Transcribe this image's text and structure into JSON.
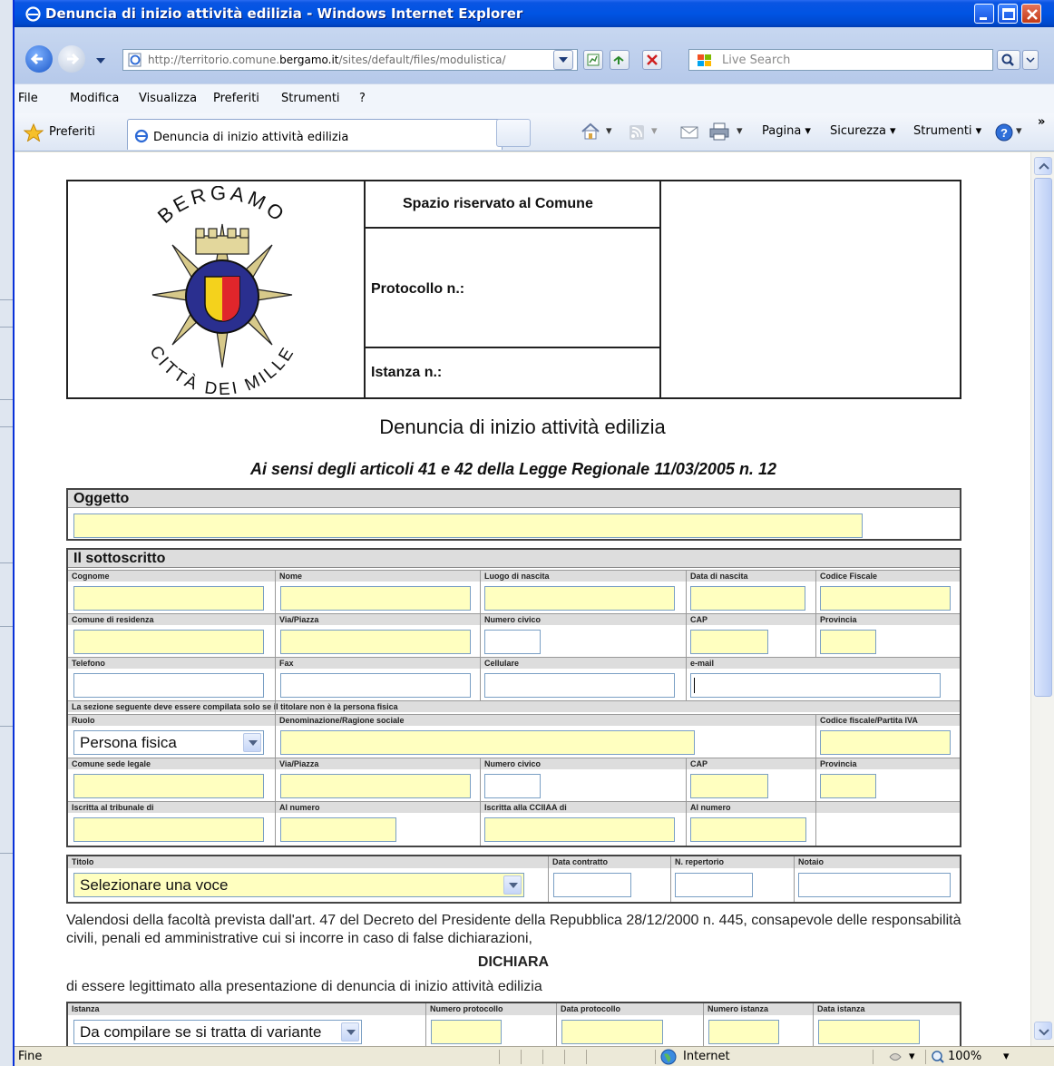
{
  "window": {
    "title": "Denuncia di inizio attività edilizia - Windows Internet Explorer"
  },
  "addressbar": {
    "url_prefix": "http://territorio.comune.",
    "url_domain": "bergamo.it",
    "url_suffix": "/sites/default/files/modulistica/",
    "search_placeholder": "Live Search"
  },
  "menu": [
    "File",
    "Modifica",
    "Visualizza",
    "Preferiti",
    "Strumenti",
    "?"
  ],
  "favbar": {
    "favorites_label": "Preferiti",
    "tab_title": "Denuncia di inizio attività edilizia",
    "commands": [
      "Pagina ▾",
      "Sicurezza ▾",
      "Strumenti ▾"
    ]
  },
  "header": {
    "logo_top": "BERGAMO",
    "logo_bottom": "CITTÀ DEI MILLE",
    "reserved": "Spazio riservato al Comune",
    "protocollo": "Protocollo n.:",
    "istanza": "Istanza n.:"
  },
  "form": {
    "title": "Denuncia di inizio attività edilizia",
    "subtitle": "Ai sensi degli articoli 41 e 42 della Legge Regionale 11/03/2005 n. 12",
    "oggetto": {
      "label": "Oggetto",
      "value": ""
    },
    "sottoscritto": {
      "label": "Il sottoscritto",
      "row1": [
        "Cognome",
        "Nome",
        "Luogo di nascita",
        "Data di nascita",
        "Codice Fiscale"
      ],
      "row2": [
        "Comune di residenza",
        "Via/Piazza",
        "Numero civico",
        "CAP",
        "Provincia"
      ],
      "row3": [
        "Telefono",
        "Fax",
        "Cellulare",
        "e-mail"
      ],
      "note": "La sezione seguente deve essere compilata solo se il titolare non è la persona fisica",
      "row4": [
        "Ruolo",
        "Denominazione/Ragione sociale",
        "Codice fiscale/Partita IVA"
      ],
      "ruolo_value": "Persona fisica",
      "row5": [
        "Comune sede legale",
        "Via/Piazza",
        "Numero civico",
        "CAP",
        "Provincia"
      ],
      "row6": [
        "Iscritta al tribunale di",
        "Al numero",
        "Iscritta alla CCIIAA di",
        "Al numero"
      ]
    },
    "titolo": {
      "labels": [
        "Titolo",
        "Data contratto",
        "N. repertorio",
        "Notaio"
      ],
      "select_value": "Selezionare una voce"
    },
    "dichiarazione": "Valendosi della facoltà prevista dall'art. 47 del Decreto del Presidente della Repubblica 28/12/2000 n. 445, consapevole delle responsabilità civili, penali ed amministrative cui si incorre in caso di false dichiarazioni,",
    "dichiara": "DICHIARA",
    "legittimato": "di essere legittimato alla presentazione di denuncia di inizio attività edilizia",
    "istanza": {
      "labels": [
        "Istanza",
        "Numero protocollo",
        "Data protocollo",
        "Numero istanza",
        "Data istanza"
      ],
      "select_value": "Da compilare se si tratta di variante"
    }
  },
  "status": {
    "left": "Fine",
    "zone": "Internet",
    "zoom": "100%"
  },
  "colors": {
    "titlebar": "#0054e3",
    "field_yellow": "#ffffc0",
    "label_gray": "#dddddd"
  }
}
